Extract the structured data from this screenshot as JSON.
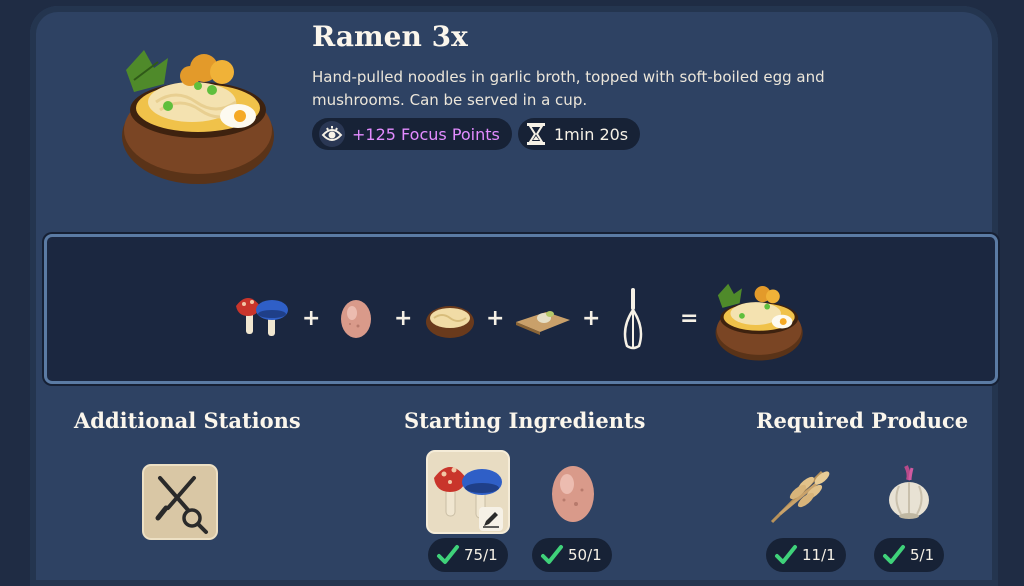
{
  "recipe": {
    "title": "Ramen 3x",
    "description": "Hand-pulled noodles in garlic broth, topped with soft-boiled egg and mushrooms. Can be served in a cup.",
    "focus_points": "+125 Focus Points",
    "time": "1min 20s"
  },
  "formula": {
    "ingredients": [
      "mushrooms-icon",
      "egg-icon",
      "noodles-bowl-icon",
      "garlic-board-icon",
      "whisk-icon"
    ],
    "result": "ramen-bowl-icon",
    "plus": "+",
    "equals": "="
  },
  "sections": {
    "additional_stations": "Additional Stations",
    "starting_ingredients": "Starting Ingredients",
    "required_produce": "Required Produce"
  },
  "stations": [
    {
      "icon": "knife-fork-magnify-icon"
    }
  ],
  "starting_ingredients": [
    {
      "icon": "mushrooms-icon",
      "count": "75/1",
      "selected": true
    },
    {
      "icon": "egg-icon",
      "count": "50/1"
    }
  ],
  "required_produce": [
    {
      "icon": "wheat-icon",
      "count": "11/1"
    },
    {
      "icon": "garlic-icon",
      "count": "5/1"
    }
  ],
  "colors": {
    "focus": "#e38cff",
    "check": "#3fd27a",
    "panel": "#2e4263",
    "recipe_border": "#5b7ba4"
  }
}
